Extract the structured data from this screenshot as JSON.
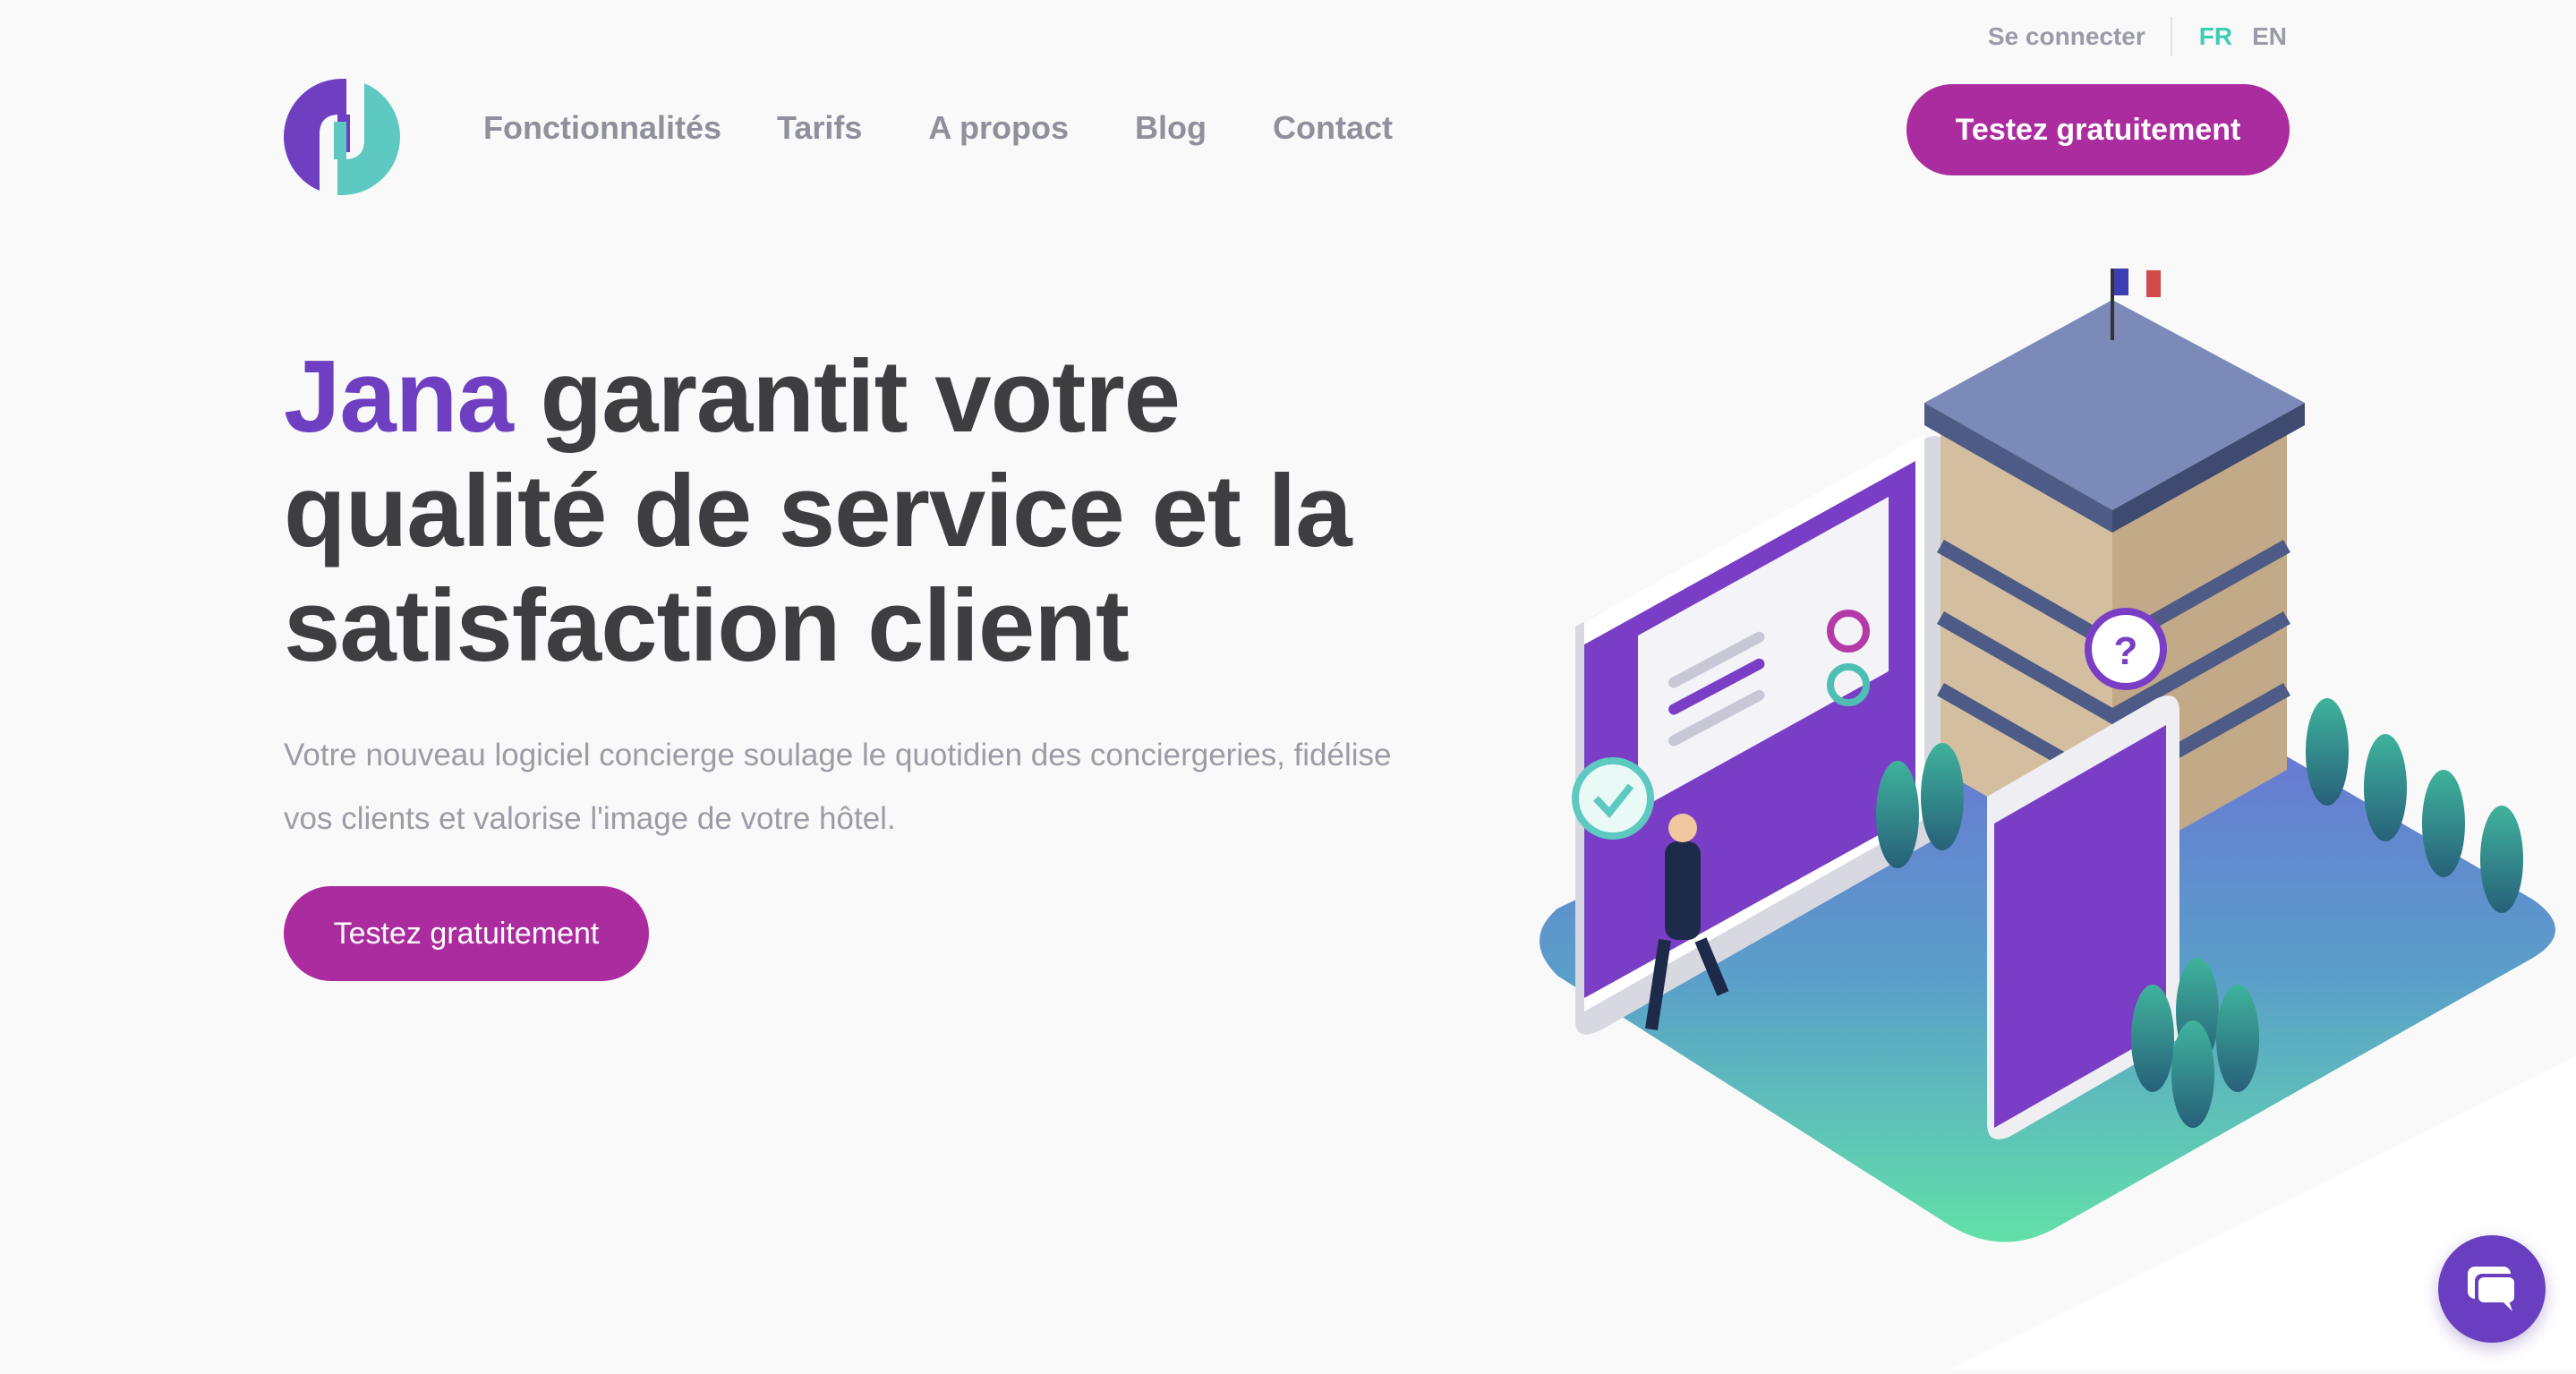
{
  "header": {
    "login_label": "Se connecter",
    "languages": [
      {
        "code": "FR",
        "active": true
      },
      {
        "code": "EN",
        "active": false
      }
    ],
    "logo_icon": "jana-logo-icon",
    "nav": [
      "Fonctionnalités",
      "Tarifs",
      "A propos",
      "Blog",
      "Contact"
    ],
    "cta_label": "Testez gratuitement"
  },
  "hero": {
    "title_accent": "Jana",
    "title_rest": "garantit votre qualité de service et la satisfaction client",
    "subtitle": "Votre nouveau logiciel concierge soulage le quotidien des conciergeries, fidélise vos clients et valorise l'image de votre hôtel.",
    "cta_label": "Testez gratuitement",
    "illustration_icon": "isometric-hotel-illustration"
  },
  "chat": {
    "icon": "chat-bubble-icon"
  },
  "colors": {
    "primary": "#ab2c9f",
    "accent_purple": "#6f3fc2",
    "accent_teal": "#3ecdb5",
    "text_dark": "#3e3e42",
    "text_muted": "#9c9ca6",
    "background": "#f9f9f9"
  }
}
